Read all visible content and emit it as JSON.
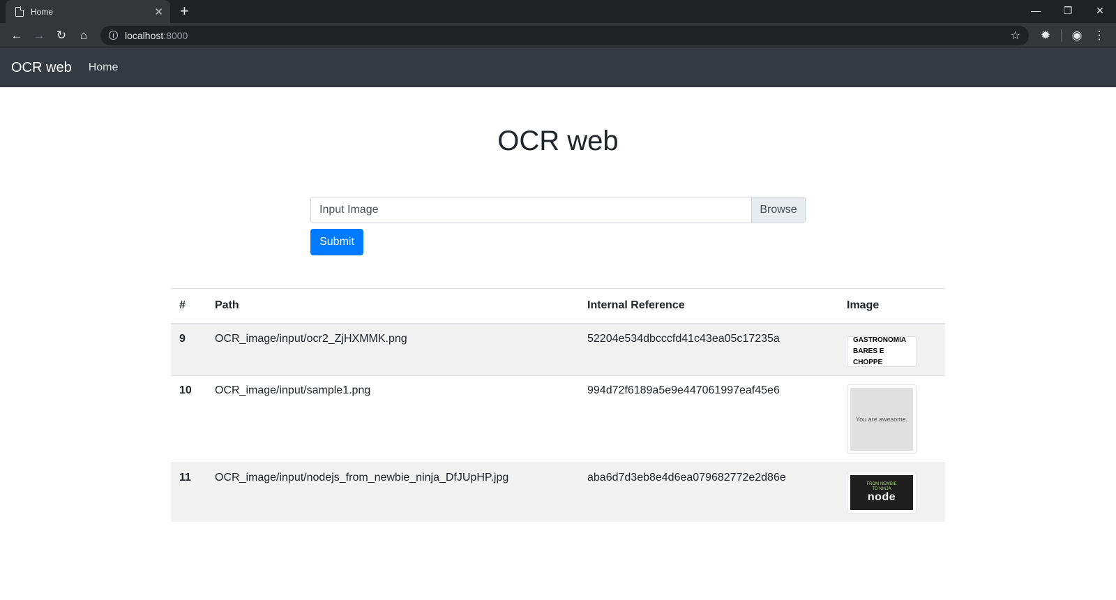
{
  "browser": {
    "tab_title": "Home",
    "url_host": "localhost",
    "url_port": ":8000"
  },
  "navbar": {
    "brand": "OCR web",
    "links": [
      "Home"
    ]
  },
  "main": {
    "title": "OCR web",
    "file_placeholder": "Input Image",
    "browse_label": "Browse",
    "submit_label": "Submit"
  },
  "table": {
    "headers": [
      "#",
      "Path",
      "Internal Reference",
      "Image"
    ],
    "rows": [
      {
        "id": "9",
        "path": "OCR_image/input/ocr2_ZjHXMMK.png",
        "ref": "52204e534dbcccfd41c43ea05c17235a",
        "thumb_line1": "GASTRONOMIA",
        "thumb_line2": "BARES E CHOPPE"
      },
      {
        "id": "10",
        "path": "OCR_image/input/sample1.png",
        "ref": "994d72f6189a5e9e447061997eaf45e6",
        "thumb_text": "You are awesome."
      },
      {
        "id": "11",
        "path": "OCR_image/input/nodejs_from_newbie_ninja_DfJUpHP.jpg",
        "ref": "aba6d7d3eb8e4d6ea079682772e2d86e",
        "thumb_line1": "FROM NEWBIE",
        "thumb_line2": "TO NINJA",
        "thumb_logo": "node"
      }
    ]
  },
  "colors": {
    "navbar_bg": "#343a40",
    "primary": "#007bff",
    "chrome_bg": "#202124"
  }
}
